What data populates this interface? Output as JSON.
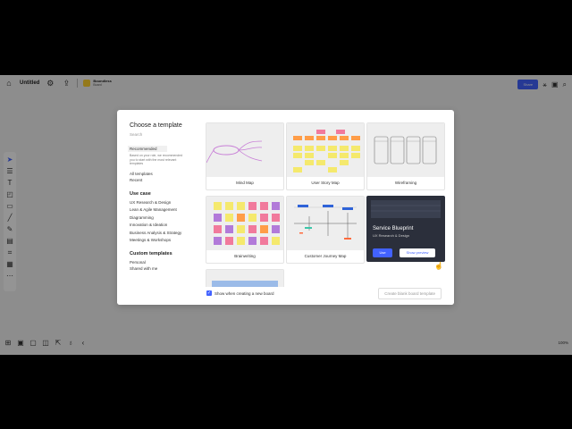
{
  "topbar": {
    "home_icon": "home-icon",
    "board_title": "Untitled",
    "promo_title": "Boundless",
    "promo_subtitle": "Board",
    "share_label": "Share"
  },
  "toolbar": {
    "icons": [
      "cursor-icon",
      "frame-icon",
      "text-icon",
      "sticky-note-icon",
      "shape-icon",
      "line-icon",
      "pen-icon",
      "comment-icon",
      "crop-icon",
      "template-icon",
      "more-icon"
    ]
  },
  "bottombar": {
    "zoom": "100%"
  },
  "modal": {
    "title": "Choose a template",
    "search_placeholder": "Search",
    "side_items": [
      {
        "label": "Recommended"
      },
      {
        "label": "All templates"
      },
      {
        "label": "Recent"
      }
    ],
    "recommended_desc": "Based on your role, we recommended you to start with the most relevant templates",
    "use_case_heading": "Use case",
    "use_cases": [
      "UX Research & Design",
      "Lean & Agile Management",
      "Diagramming",
      "Innovation & Ideation",
      "Business Analysis & Strategy",
      "Meetings & Workshops"
    ],
    "custom_heading": "Custom templates",
    "custom_items": [
      "Personal",
      "Shared with me"
    ],
    "cards": [
      {
        "label": "Mind Map"
      },
      {
        "label": "User Story Map"
      },
      {
        "label": "Wireframing"
      },
      {
        "label": "Brainwriting"
      },
      {
        "label": "Customer Journey Map"
      },
      {
        "label": "Service Blueprint",
        "sub": "UX Research & Design",
        "use": "Use",
        "preview": "Show preview"
      }
    ],
    "footer": {
      "checkbox_label": "Show when creating a new board",
      "button_label": "Create blank board template"
    }
  },
  "colors": {
    "accent": "#4262ff",
    "sticky_yellow": "#f5e96d",
    "sticky_pink": "#f17a9c",
    "sticky_purple": "#b27ad9",
    "sticky_orange": "#ff9d48"
  }
}
